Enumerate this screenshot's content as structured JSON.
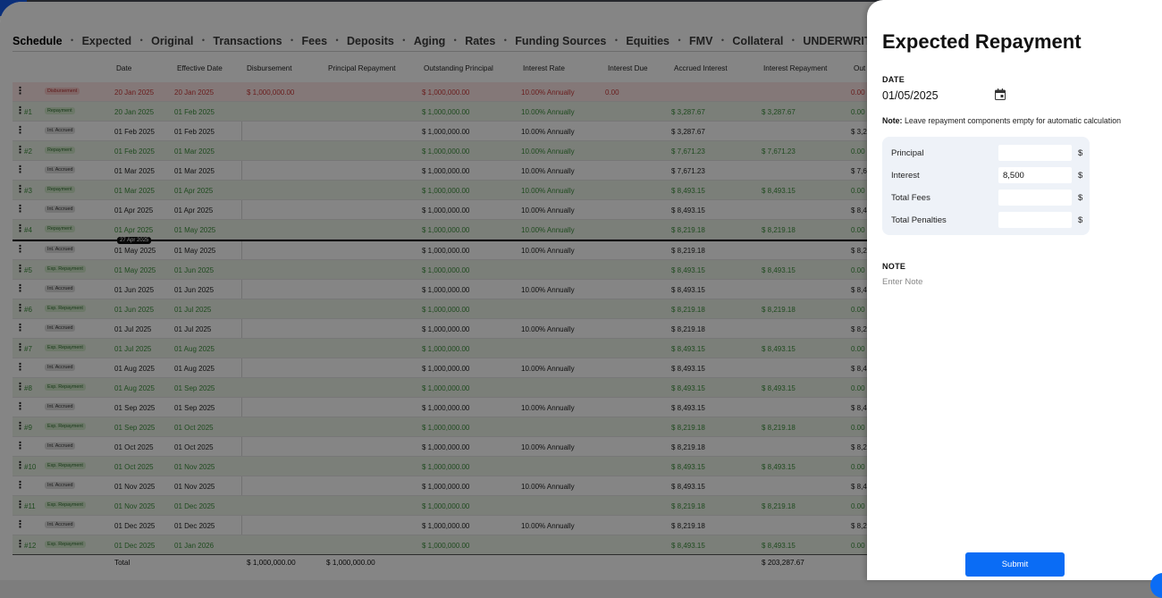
{
  "tabs": [
    "Schedule",
    "Expected",
    "Original",
    "Transactions",
    "Fees",
    "Deposits",
    "Aging",
    "Rates",
    "Funding Sources",
    "Equities",
    "FMV",
    "Collateral",
    "UNDERWRITING CHECKLIST"
  ],
  "table": {
    "headers": [
      "Date",
      "Effective Date",
      "Disbursement",
      "Principal Repayment",
      "Outstanding Principal",
      "Interest Rate",
      "Interest Due",
      "Accrued Interest",
      "Interest Repayment",
      "Out"
    ],
    "rows": [
      {
        "no": "",
        "type": "Disbursement",
        "kind": "disb",
        "date": "20 Jan 2025",
        "eff": "20 Jan 2025",
        "disb": "$ 1,000,000.00",
        "out": "$ 1,000,000.00",
        "rate": "10.00% Annually",
        "due": "0.00",
        "acc": "",
        "irep": "",
        "last": "0.00"
      },
      {
        "no": "#1",
        "type": "Repayment",
        "kind": "rep",
        "date": "20 Jan 2025",
        "eff": "01 Feb 2025",
        "disb": "",
        "out": "$ 1,000,000.00",
        "rate": "10.00% Annually",
        "due": "",
        "acc": "$ 3,287.67",
        "irep": "$ 3,287.67",
        "last": "0.00"
      },
      {
        "no": "",
        "type": "Int. Accrued",
        "kind": "acc",
        "date": "01 Feb 2025",
        "eff": "01 Feb 2025",
        "disb": "",
        "out": "$ 1,000,000.00",
        "rate": "10.00% Annually",
        "due": "",
        "acc": "$ 3,287.67",
        "irep": "",
        "last": "$ 3,2"
      },
      {
        "no": "#2",
        "type": "Repayment",
        "kind": "rep",
        "date": "01 Feb 2025",
        "eff": "01 Mar 2025",
        "disb": "",
        "out": "$ 1,000,000.00",
        "rate": "10.00% Annually",
        "due": "",
        "acc": "$ 7,671.23",
        "irep": "$ 7,671.23",
        "last": "0.00"
      },
      {
        "no": "",
        "type": "Int. Accrued",
        "kind": "acc",
        "date": "01 Mar 2025",
        "eff": "01 Mar 2025",
        "disb": "",
        "out": "$ 1,000,000.00",
        "rate": "10.00% Annually",
        "due": "",
        "acc": "$ 7,671.23",
        "irep": "",
        "last": "$ 7,6"
      },
      {
        "no": "#3",
        "type": "Repayment",
        "kind": "rep",
        "date": "01 Mar 2025",
        "eff": "01 Apr 2025",
        "disb": "",
        "out": "$ 1,000,000.00",
        "rate": "10.00% Annually",
        "due": "",
        "acc": "$ 8,493.15",
        "irep": "$ 8,493.15",
        "last": "0.00"
      },
      {
        "no": "",
        "type": "Int. Accrued",
        "kind": "acc",
        "date": "01 Apr 2025",
        "eff": "01 Apr 2025",
        "disb": "",
        "out": "$ 1,000,000.00",
        "rate": "10.00% Annually",
        "due": "",
        "acc": "$ 8,493.15",
        "irep": "",
        "last": "$ 8,4"
      },
      {
        "no": "#4",
        "type": "Repayment",
        "kind": "rep",
        "date": "01 Apr 2025",
        "eff": "01 May 2025",
        "disb": "",
        "out": "$ 1,000,000.00",
        "rate": "10.00% Annually",
        "due": "",
        "acc": "$ 8,219.18",
        "irep": "$ 8,219.18",
        "last": "0.00"
      },
      {
        "no": "",
        "type": "Int. Accrued",
        "kind": "acc",
        "date": "01 May 2025",
        "eff": "01 May 2025",
        "disb": "",
        "out": "$ 1,000,000.00",
        "rate": "10.00% Annually",
        "due": "",
        "acc": "$ 8,219.18",
        "irep": "",
        "last": "$ 8,2"
      },
      {
        "no": "#5",
        "type": "Exp. Repayment",
        "kind": "rep",
        "date": "01 May 2025",
        "eff": "01 Jun 2025",
        "disb": "",
        "out": "$ 1,000,000.00",
        "rate": "",
        "due": "",
        "acc": "$ 8,493.15",
        "irep": "$ 8,493.15",
        "last": "0.00"
      },
      {
        "no": "",
        "type": "Int. Accrued",
        "kind": "acc",
        "date": "01 Jun 2025",
        "eff": "01 Jun 2025",
        "disb": "",
        "out": "$ 1,000,000.00",
        "rate": "10.00% Annually",
        "due": "",
        "acc": "$ 8,493.15",
        "irep": "",
        "last": "$ 8,4"
      },
      {
        "no": "#6",
        "type": "Exp. Repayment",
        "kind": "rep",
        "date": "01 Jun 2025",
        "eff": "01 Jul 2025",
        "disb": "",
        "out": "$ 1,000,000.00",
        "rate": "",
        "due": "",
        "acc": "$ 8,219.18",
        "irep": "$ 8,219.18",
        "last": "0.00"
      },
      {
        "no": "",
        "type": "Int. Accrued",
        "kind": "acc",
        "date": "01 Jul 2025",
        "eff": "01 Jul 2025",
        "disb": "",
        "out": "$ 1,000,000.00",
        "rate": "10.00% Annually",
        "due": "",
        "acc": "$ 8,219.18",
        "irep": "",
        "last": "$ 8,2"
      },
      {
        "no": "#7",
        "type": "Exp. Repayment",
        "kind": "rep",
        "date": "01 Jul 2025",
        "eff": "01 Aug 2025",
        "disb": "",
        "out": "$ 1,000,000.00",
        "rate": "",
        "due": "",
        "acc": "$ 8,493.15",
        "irep": "$ 8,493.15",
        "last": "0.00"
      },
      {
        "no": "",
        "type": "Int. Accrued",
        "kind": "acc",
        "date": "01 Aug 2025",
        "eff": "01 Aug 2025",
        "disb": "",
        "out": "$ 1,000,000.00",
        "rate": "10.00% Annually",
        "due": "",
        "acc": "$ 8,493.15",
        "irep": "",
        "last": "$ 8,4"
      },
      {
        "no": "#8",
        "type": "Exp. Repayment",
        "kind": "rep",
        "date": "01 Aug 2025",
        "eff": "01 Sep 2025",
        "disb": "",
        "out": "$ 1,000,000.00",
        "rate": "",
        "due": "",
        "acc": "$ 8,493.15",
        "irep": "$ 8,493.15",
        "last": "0.00"
      },
      {
        "no": "",
        "type": "Int. Accrued",
        "kind": "acc",
        "date": "01 Sep 2025",
        "eff": "01 Sep 2025",
        "disb": "",
        "out": "$ 1,000,000.00",
        "rate": "10.00% Annually",
        "due": "",
        "acc": "$ 8,493.15",
        "irep": "",
        "last": "$ 8,4"
      },
      {
        "no": "#9",
        "type": "Exp. Repayment",
        "kind": "rep",
        "date": "01 Sep 2025",
        "eff": "01 Oct 2025",
        "disb": "",
        "out": "$ 1,000,000.00",
        "rate": "",
        "due": "",
        "acc": "$ 8,219.18",
        "irep": "$ 8,219.18",
        "last": "0.00"
      },
      {
        "no": "",
        "type": "Int. Accrued",
        "kind": "acc",
        "date": "01 Oct 2025",
        "eff": "01 Oct 2025",
        "disb": "",
        "out": "$ 1,000,000.00",
        "rate": "10.00% Annually",
        "due": "",
        "acc": "$ 8,219.18",
        "irep": "",
        "last": "$ 8,2"
      },
      {
        "no": "#10",
        "type": "Exp. Repayment",
        "kind": "rep",
        "date": "01 Oct 2025",
        "eff": "01 Nov 2025",
        "disb": "",
        "out": "$ 1,000,000.00",
        "rate": "",
        "due": "",
        "acc": "$ 8,493.15",
        "irep": "$ 8,493.15",
        "last": "0.00"
      },
      {
        "no": "",
        "type": "Int. Accrued",
        "kind": "acc",
        "date": "01 Nov 2025",
        "eff": "01 Nov 2025",
        "disb": "",
        "out": "$ 1,000,000.00",
        "rate": "10.00% Annually",
        "due": "",
        "acc": "$ 8,493.15",
        "irep": "",
        "last": "$ 8,4"
      },
      {
        "no": "#11",
        "type": "Exp. Repayment",
        "kind": "rep",
        "date": "01 Nov 2025",
        "eff": "01 Dec 2025",
        "disb": "",
        "out": "$ 1,000,000.00",
        "rate": "",
        "due": "",
        "acc": "$ 8,219.18",
        "irep": "$ 8,219.18",
        "last": "0.00"
      },
      {
        "no": "",
        "type": "Int. Accrued",
        "kind": "acc",
        "date": "01 Dec 2025",
        "eff": "01 Dec 2025",
        "disb": "",
        "out": "$ 1,000,000.00",
        "rate": "10.00% Annually",
        "due": "",
        "acc": "$ 8,219.18",
        "irep": "",
        "last": "$ 8,2"
      },
      {
        "no": "#12",
        "type": "Exp. Repayment",
        "kind": "rep",
        "date": "01 Dec 2025",
        "eff": "01 Jan 2026",
        "disb": "",
        "out": "$ 1,000,000.00",
        "rate": "",
        "due": "",
        "acc": "$ 8,493.15",
        "irep": "$ 8,493.15",
        "last": "0.00"
      }
    ],
    "today_marker": "27 Apr 2025",
    "totals": {
      "label": "Total",
      "disb": "$ 1,000,000.00",
      "prin": "$ 1,000,000.00",
      "irep": "$ 203,287.67"
    }
  },
  "panel": {
    "title": "Expected Repayment",
    "date_label": "DATE",
    "date_value": "01/05/2025",
    "note_bold": "Note:",
    "note_text": "Leave repayment components empty for automatic calculation",
    "components": [
      {
        "label": "Principal",
        "value": "",
        "currency": "$"
      },
      {
        "label": "Interest",
        "value": "8,500",
        "currency": "$"
      },
      {
        "label": "Total Fees",
        "value": "",
        "currency": "$"
      },
      {
        "label": "Total Penalties",
        "value": "",
        "currency": "$"
      }
    ],
    "note_label": "NOTE",
    "note_placeholder": "Enter Note",
    "submit_label": "Submit"
  },
  "colors": {
    "accent": "#0a6cf5",
    "repayment_green": "#3d8f3d",
    "disbursement_red": "#cc3b3b",
    "panel_bg": "#eef2f8"
  }
}
